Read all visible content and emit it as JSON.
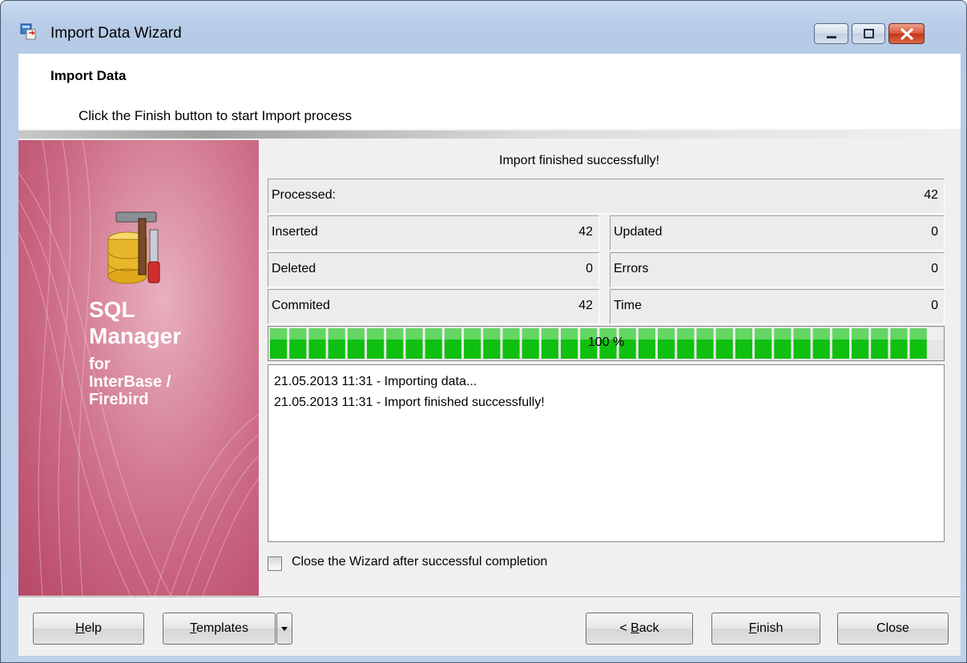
{
  "window": {
    "title": "Import Data Wizard"
  },
  "header": {
    "title": "Import Data",
    "subtitle": "Click the Finish button to start Import process"
  },
  "banner": {
    "line1": "SQL",
    "line2": "Manager",
    "line3": "for",
    "line4": "InterBase /",
    "line5": "Firebird"
  },
  "status": {
    "message": "Import finished successfully!"
  },
  "stats": {
    "processed": {
      "label": "Processed:",
      "value": "42"
    },
    "inserted": {
      "label": "Inserted",
      "value": "42"
    },
    "updated": {
      "label": "Updated",
      "value": "0"
    },
    "deleted": {
      "label": "Deleted",
      "value": "0"
    },
    "errors": {
      "label": "Errors",
      "value": "0"
    },
    "commited": {
      "label": "Commited",
      "value": "42"
    },
    "time": {
      "label": "Time",
      "value": "0"
    }
  },
  "progress": {
    "value": 1.0,
    "label": "100 %",
    "color": "#10c010"
  },
  "log": [
    "21.05.2013 11:31 - Importing data...",
    "21.05.2013 11:31 - Import finished successfully!"
  ],
  "close_option": {
    "label": "Close the Wizard after successful completion",
    "checked": false
  },
  "buttons": {
    "help": {
      "key": "H",
      "rest": "elp"
    },
    "templates": {
      "key": "T",
      "rest": "emplates"
    },
    "back": {
      "prefix": "< ",
      "key": "B",
      "rest": "ack"
    },
    "finish": {
      "key": "F",
      "rest": "inish"
    },
    "close": "Close"
  },
  "icons": {
    "app": "import-wizard-icon",
    "banner": "database-tools-icon",
    "minimize": "minimize-icon",
    "maximize": "maximize-icon",
    "close": "close-icon",
    "dropdown": "chevron-down-icon"
  }
}
